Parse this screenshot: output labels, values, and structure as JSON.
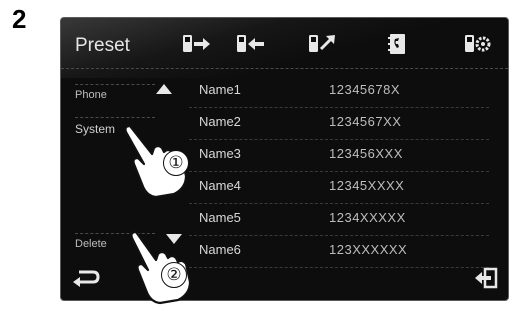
{
  "step_number": "2",
  "header": {
    "title": "Preset",
    "icons": [
      "phone-send-icon",
      "phone-receive-icon",
      "phone-signal-icon",
      "phonebook-icon",
      "phone-settings-icon"
    ]
  },
  "sidebar": {
    "phone_label": "Phone",
    "system_label": "System",
    "delete_label": "Delete"
  },
  "contacts": [
    {
      "name": "Name1",
      "number": "12345678X"
    },
    {
      "name": "Name2",
      "number": "1234567XX"
    },
    {
      "name": "Name3",
      "number": "123456XXX"
    },
    {
      "name": "Name4",
      "number": "12345XXXX"
    },
    {
      "name": "Name5",
      "number": "1234XXXXX"
    },
    {
      "name": "Name6",
      "number": "123XXXXXX"
    }
  ],
  "callouts": [
    "①",
    "②"
  ],
  "colors": {
    "screen_bg": "#0d0d0d",
    "text": "#d8d8d8"
  }
}
